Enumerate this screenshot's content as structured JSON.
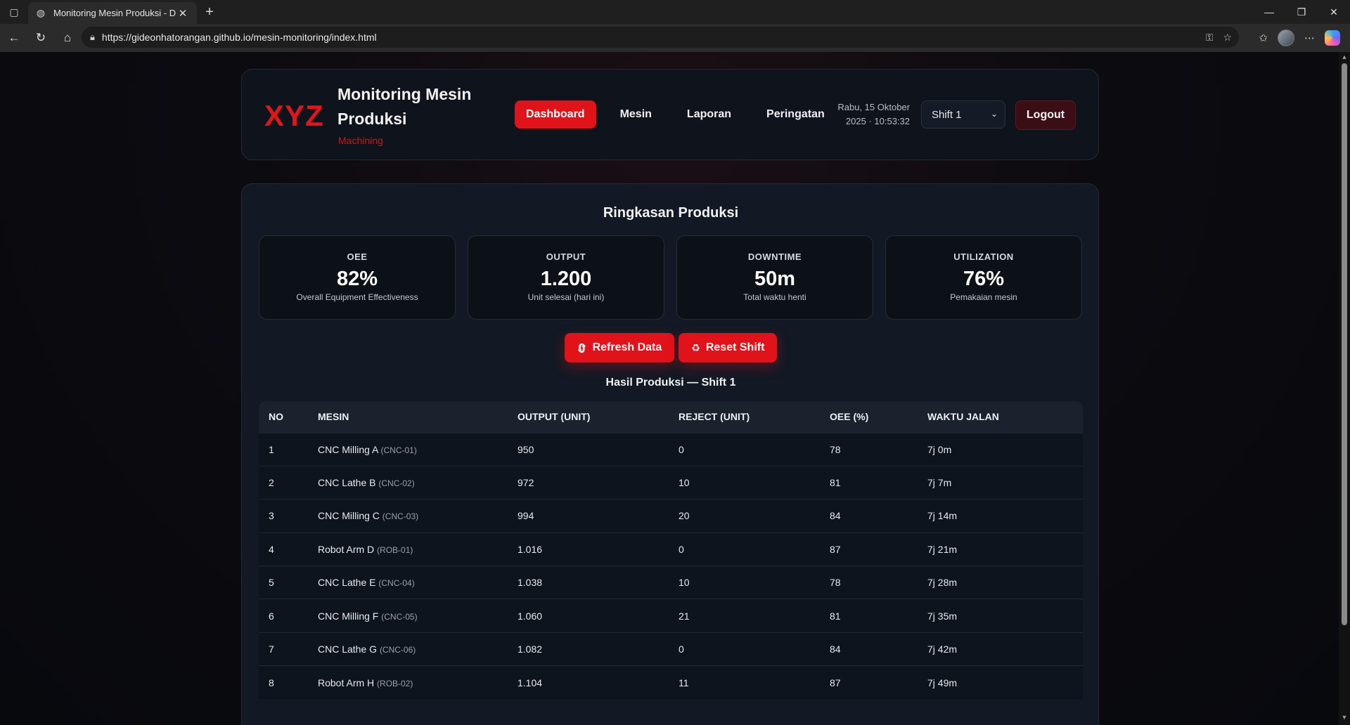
{
  "browser": {
    "tab_title": "Monitoring Mesin Produksi - Dash",
    "url": "https://gideonhatorangan.github.io/mesin-monitoring/index.html"
  },
  "header": {
    "logo": "XYZ",
    "title": "Monitoring Mesin Produksi",
    "subtitle": "Machining",
    "nav": [
      "Dashboard",
      "Mesin",
      "Laporan",
      "Peringatan"
    ],
    "active_nav": "Dashboard",
    "date_line1": "Rabu, 15 Oktober",
    "date_line2": "2025 · 10:53:32",
    "shift_selected": "Shift 1",
    "logout_label": "Logout"
  },
  "summary": {
    "title": "Ringkasan Produksi",
    "kpis": [
      {
        "label": "OEE",
        "value": "82%",
        "sub": "Overall Equipment Effectiveness"
      },
      {
        "label": "OUTPUT",
        "value": "1.200",
        "sub": "Unit selesai (hari ini)"
      },
      {
        "label": "DOWNTIME",
        "value": "50m",
        "sub": "Total waktu henti"
      },
      {
        "label": "UTILIZATION",
        "value": "76%",
        "sub": "Pemakaian mesin"
      }
    ],
    "refresh_label": "Refresh Data",
    "reset_label": "Reset Shift"
  },
  "table": {
    "caption": "Hasil Produksi — Shift 1",
    "columns": [
      "NO",
      "MESIN",
      "OUTPUT (UNIT)",
      "REJECT (UNIT)",
      "OEE (%)",
      "WAKTU JALAN"
    ],
    "rows": [
      {
        "no": "1",
        "name": "CNC Milling A",
        "code": "(CNC-01)",
        "output": "950",
        "reject": "0",
        "oee": "78",
        "runtime": "7j 0m"
      },
      {
        "no": "2",
        "name": "CNC Lathe B",
        "code": "(CNC-02)",
        "output": "972",
        "reject": "10",
        "oee": "81",
        "runtime": "7j 7m"
      },
      {
        "no": "3",
        "name": "CNC Milling C",
        "code": "(CNC-03)",
        "output": "994",
        "reject": "20",
        "oee": "84",
        "runtime": "7j 14m"
      },
      {
        "no": "4",
        "name": "Robot Arm D",
        "code": "(ROB-01)",
        "output": "1.016",
        "reject": "0",
        "oee": "87",
        "runtime": "7j 21m"
      },
      {
        "no": "5",
        "name": "CNC Lathe E",
        "code": "(CNC-04)",
        "output": "1.038",
        "reject": "10",
        "oee": "78",
        "runtime": "7j 28m"
      },
      {
        "no": "6",
        "name": "CNC Milling F",
        "code": "(CNC-05)",
        "output": "1.060",
        "reject": "21",
        "oee": "81",
        "runtime": "7j 35m"
      },
      {
        "no": "7",
        "name": "CNC Lathe G",
        "code": "(CNC-06)",
        "output": "1.082",
        "reject": "0",
        "oee": "84",
        "runtime": "7j 42m"
      },
      {
        "no": "8",
        "name": "Robot Arm H",
        "code": "(ROB-02)",
        "output": "1.104",
        "reject": "11",
        "oee": "87",
        "runtime": "7j 49m"
      }
    ]
  },
  "colors": {
    "accent": "#e0121a",
    "background": "#0b0c11",
    "card": "#121924"
  }
}
